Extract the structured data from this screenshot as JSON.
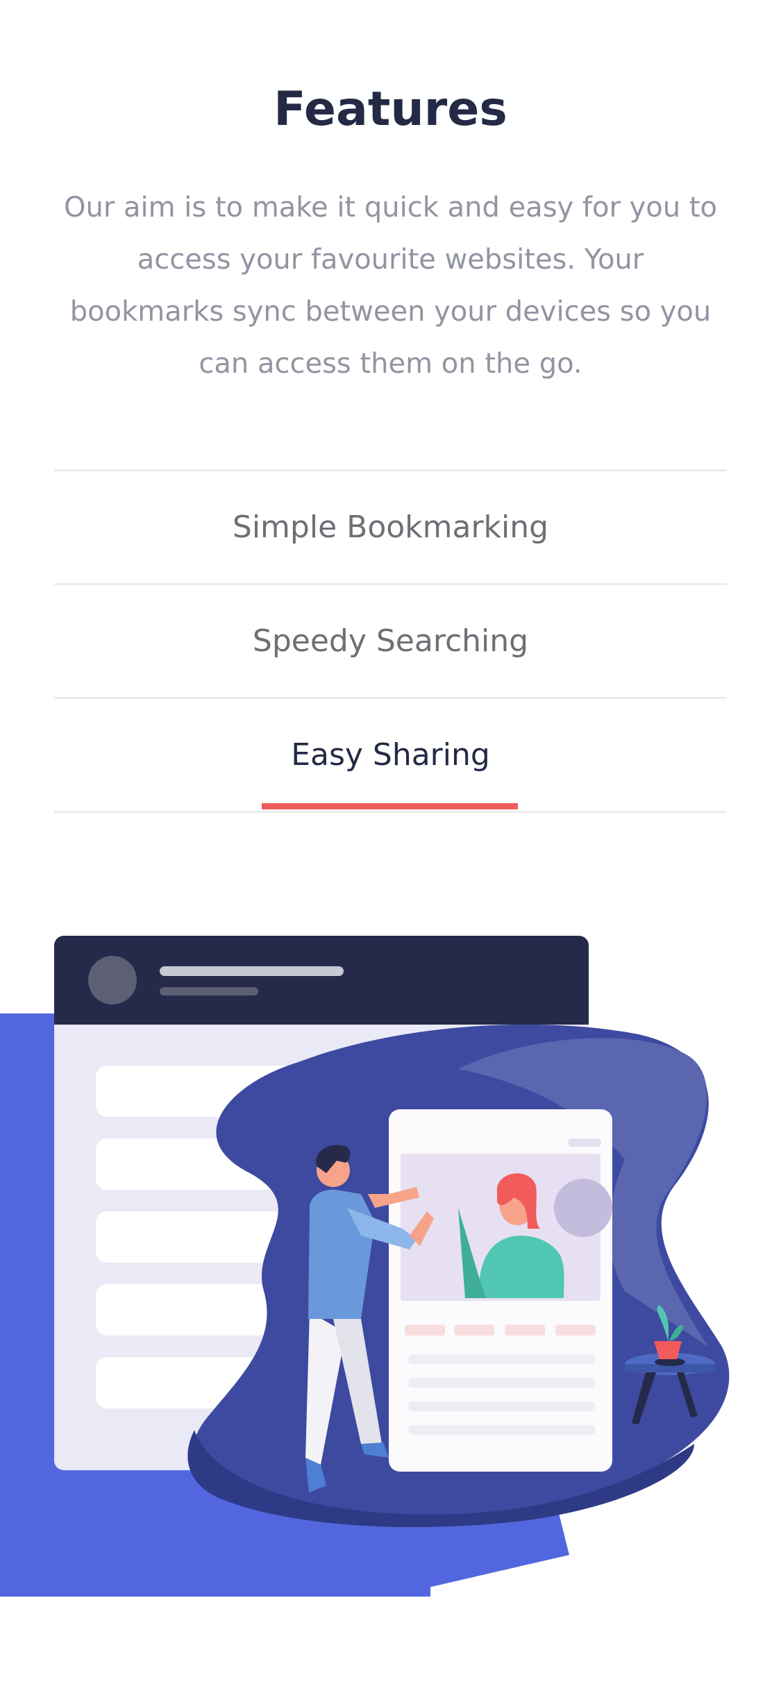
{
  "features": {
    "title": "Features",
    "description": "Our aim is to make it quick and easy for you to access your favourite websites. Your bookmarks sync between your devices so you can access them on the go.",
    "tabs": [
      {
        "label": "Simple Bookmarking",
        "active": false
      },
      {
        "label": "Speedy Searching",
        "active": false
      },
      {
        "label": "Easy Sharing",
        "active": true
      }
    ]
  },
  "next_section": {
    "title": ""
  },
  "colors": {
    "heading": "#242a45",
    "body_text": "#9194a1",
    "accent_red": "#f25b5b",
    "accent_blue": "#5267df",
    "blob_blue": "#3e4aa0"
  }
}
